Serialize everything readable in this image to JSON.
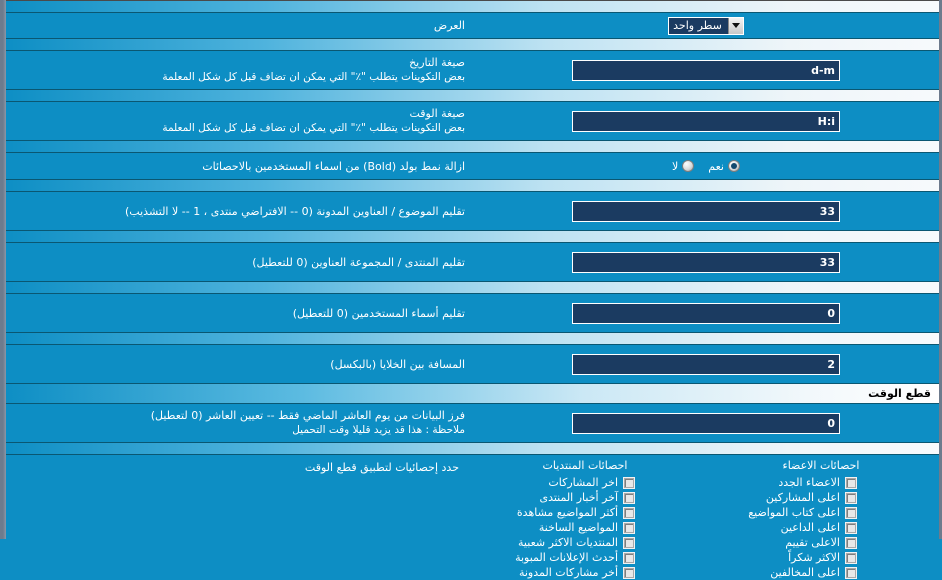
{
  "theme": {
    "background": "#0d8ec4",
    "input_background": "#1b3b61",
    "text": "#ffffff",
    "section_title": "#000000",
    "border": "#6d7b8d"
  },
  "rows": [
    {
      "id": "display-mode",
      "label": "العرض",
      "desc": "",
      "control": "select",
      "value": "سطر واحد",
      "options": [
        "سطر واحد"
      ]
    },
    {
      "id": "date-format",
      "label": "صيغة التاريخ",
      "desc": "بعض التكوينات يتطلب  \"٪\"  التي يمكن ان تضاف قبل كل شكل المعلمة",
      "control": "text",
      "value": "d-m"
    },
    {
      "id": "time-format",
      "label": "صيغة الوقت",
      "desc": "بعض التكوينات يتطلب  \"٪\"  التي يمكن ان تضاف قبل كل شكل المعلمة",
      "control": "text",
      "value": "H:i"
    },
    {
      "id": "remove-bold",
      "label": "ازالة نمط بولد (Bold) من اسماء المستخدمين بالاحصائات",
      "desc": "",
      "control": "radio",
      "value": "نعم",
      "options": [
        "نعم",
        "لا"
      ]
    },
    {
      "id": "trim-topic-titles",
      "label": "تقليم الموضوع / العناوين المدونة (0 -- الافتراضي منتدى ، 1 -- لا التشذيب)",
      "desc": "",
      "control": "text",
      "value": "33"
    },
    {
      "id": "trim-forum-titles",
      "label": "تقليم المنتدى / المجموعة العناوين (0 للتعطيل)",
      "desc": "",
      "control": "text",
      "value": "33"
    },
    {
      "id": "trim-usernames",
      "label": "تقليم أسماء المستخدمين (0 للتعطيل)",
      "desc": "",
      "control": "text",
      "value": "0"
    },
    {
      "id": "cell-spacing",
      "label": "المسافة بين الخلايا (بالبكسل)",
      "desc": "",
      "control": "text",
      "value": "2"
    }
  ],
  "section": {
    "title": "قطع الوقت",
    "cutoff_row": {
      "id": "cutoff-days",
      "label": "فرز البيانات من يوم العاشر الماضي فقط -- تعيين العاشر (0 لتعطيل)",
      "desc": "ملاحظة : هذا قد يزيد قليلا وقت التحميل",
      "control": "text",
      "value": "0"
    },
    "stats_row": {
      "label": "حدد إحصائيات لتطبيق قطع الوقت",
      "columns": [
        {
          "id": "forum-stats",
          "title": "احصائات المنتديات",
          "items": [
            {
              "label": "اخر المشاركات",
              "checked": false
            },
            {
              "label": "آخر أخبار المنتدى",
              "checked": false
            },
            {
              "label": "أكثر المواضيع مشاهدة",
              "checked": false
            },
            {
              "label": "المواضيع الساخنة",
              "checked": false
            },
            {
              "label": "المنتديات الاكثر شعبية",
              "checked": false
            },
            {
              "label": "أحدث الإعلانات المبوبة",
              "checked": false
            },
            {
              "label": "أخر مشاركات المدونة",
              "checked": false
            }
          ]
        },
        {
          "id": "member-stats",
          "title": "احصائات الاعضاء",
          "items": [
            {
              "label": "الاعضاء الجدد",
              "checked": false
            },
            {
              "label": "اعلى المشاركين",
              "checked": false
            },
            {
              "label": "اعلى كتاب المواضيع",
              "checked": false
            },
            {
              "label": "اعلى الداعين",
              "checked": false
            },
            {
              "label": "الاعلى تقييم",
              "checked": false
            },
            {
              "label": "الاكثر شكراً",
              "checked": false
            },
            {
              "label": "اعلى المخالفين",
              "checked": false
            }
          ]
        }
      ]
    }
  }
}
